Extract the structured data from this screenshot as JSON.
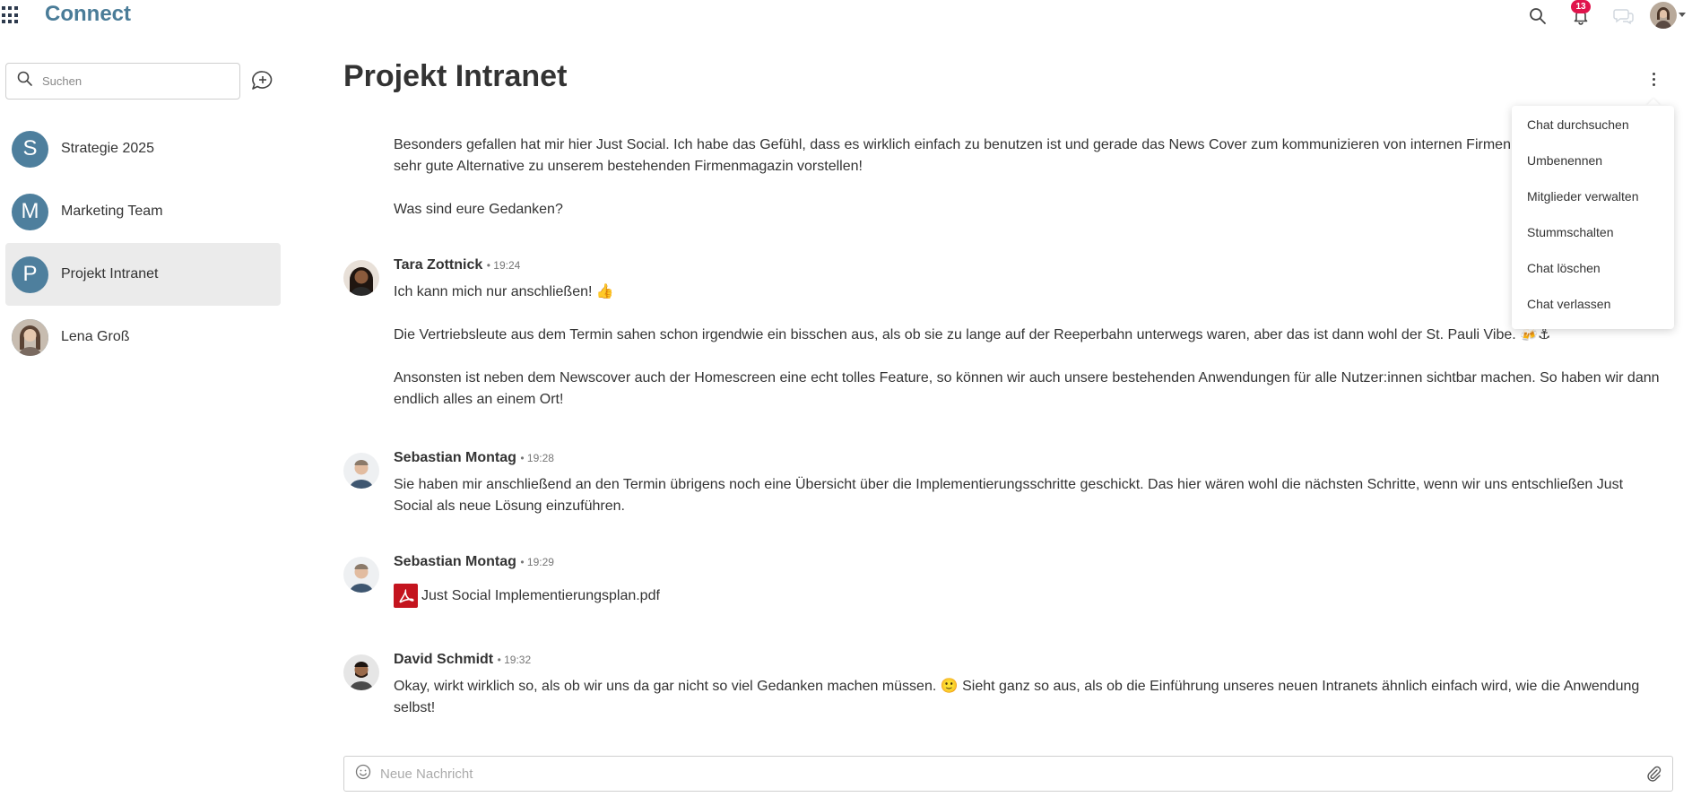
{
  "app": {
    "title": "Connect"
  },
  "topbar": {
    "notification_count": "13"
  },
  "sidebar": {
    "search_placeholder": "Suchen",
    "chats": [
      {
        "initial": "S",
        "name": "Strategie 2025"
      },
      {
        "initial": "M",
        "name": "Marketing Team"
      },
      {
        "initial": "P",
        "name": "Projekt Intranet"
      },
      {
        "initial": "",
        "name": "Lena Groß"
      }
    ]
  },
  "main": {
    "title": "Projekt Intranet",
    "intro": {
      "line1": "Besonders gefallen hat mir hier Just Social. Ich habe das Gefühl, dass es wirklich einfach zu benutzen ist und gerade das News Cover zum kommunizieren von internen Firmennew",
      "line2": "sehr gute Alternative zu unserem bestehenden Firmenmagazin vorstellen!",
      "line3": "Was sind eure Gedanken?"
    },
    "messages": [
      {
        "author": "Tara Zottnick",
        "time": "• 19:24",
        "p1": "Ich kann mich nur anschließen! 👍",
        "p2": "Die Vertriebsleute aus dem Termin sahen schon irgendwie ein bisschen aus, als ob sie zu lange auf der Reeperbahn unterwegs waren, aber das ist dann wohl der St. Pauli Vibe. 🍻⚓",
        "p3": "Ansonsten ist neben dem Newscover auch der Homescreen eine echt tolles Feature, so können wir auch unsere bestehenden Anwendungen für alle Nutzer:innen sichtbar machen. So haben wir dann endlich alles an einem Ort!"
      },
      {
        "author": "Sebastian Montag",
        "time": "• 19:28",
        "p1": "Sie haben mir anschließend an den Termin übrigens noch eine Übersicht über die Implementierungsschritte geschickt. Das hier wären wohl die nächsten Schritte, wenn wir uns entschließen Just Social als neue Lösung einzuführen."
      },
      {
        "author": "Sebastian Montag",
        "time": "• 19:29",
        "attachment": "Just Social Implementierungsplan.pdf"
      },
      {
        "author": "David Schmidt",
        "time": "• 19:32",
        "p1": "Okay, wirkt wirklich so, als ob wir uns da gar nicht so viel Gedanken machen müssen. 🙂 Sieht ganz so aus, als ob die Einführung unseres neuen Intranets ähnlich einfach wird, wie die Anwendung selbst!"
      }
    ],
    "composer_placeholder": "Neue Nachricht"
  },
  "menu": {
    "items": [
      "Chat durchsuchen",
      "Umbenennen",
      "Mitglieder verwalten",
      "Stummschalten",
      "Chat löschen",
      "Chat verlassen"
    ]
  },
  "colors": {
    "brand": "#4a7c98",
    "avatar": "#4e7f9d",
    "badge": "#e0144c",
    "pdf": "#c4141e",
    "active_bg": "#ebebeb"
  }
}
